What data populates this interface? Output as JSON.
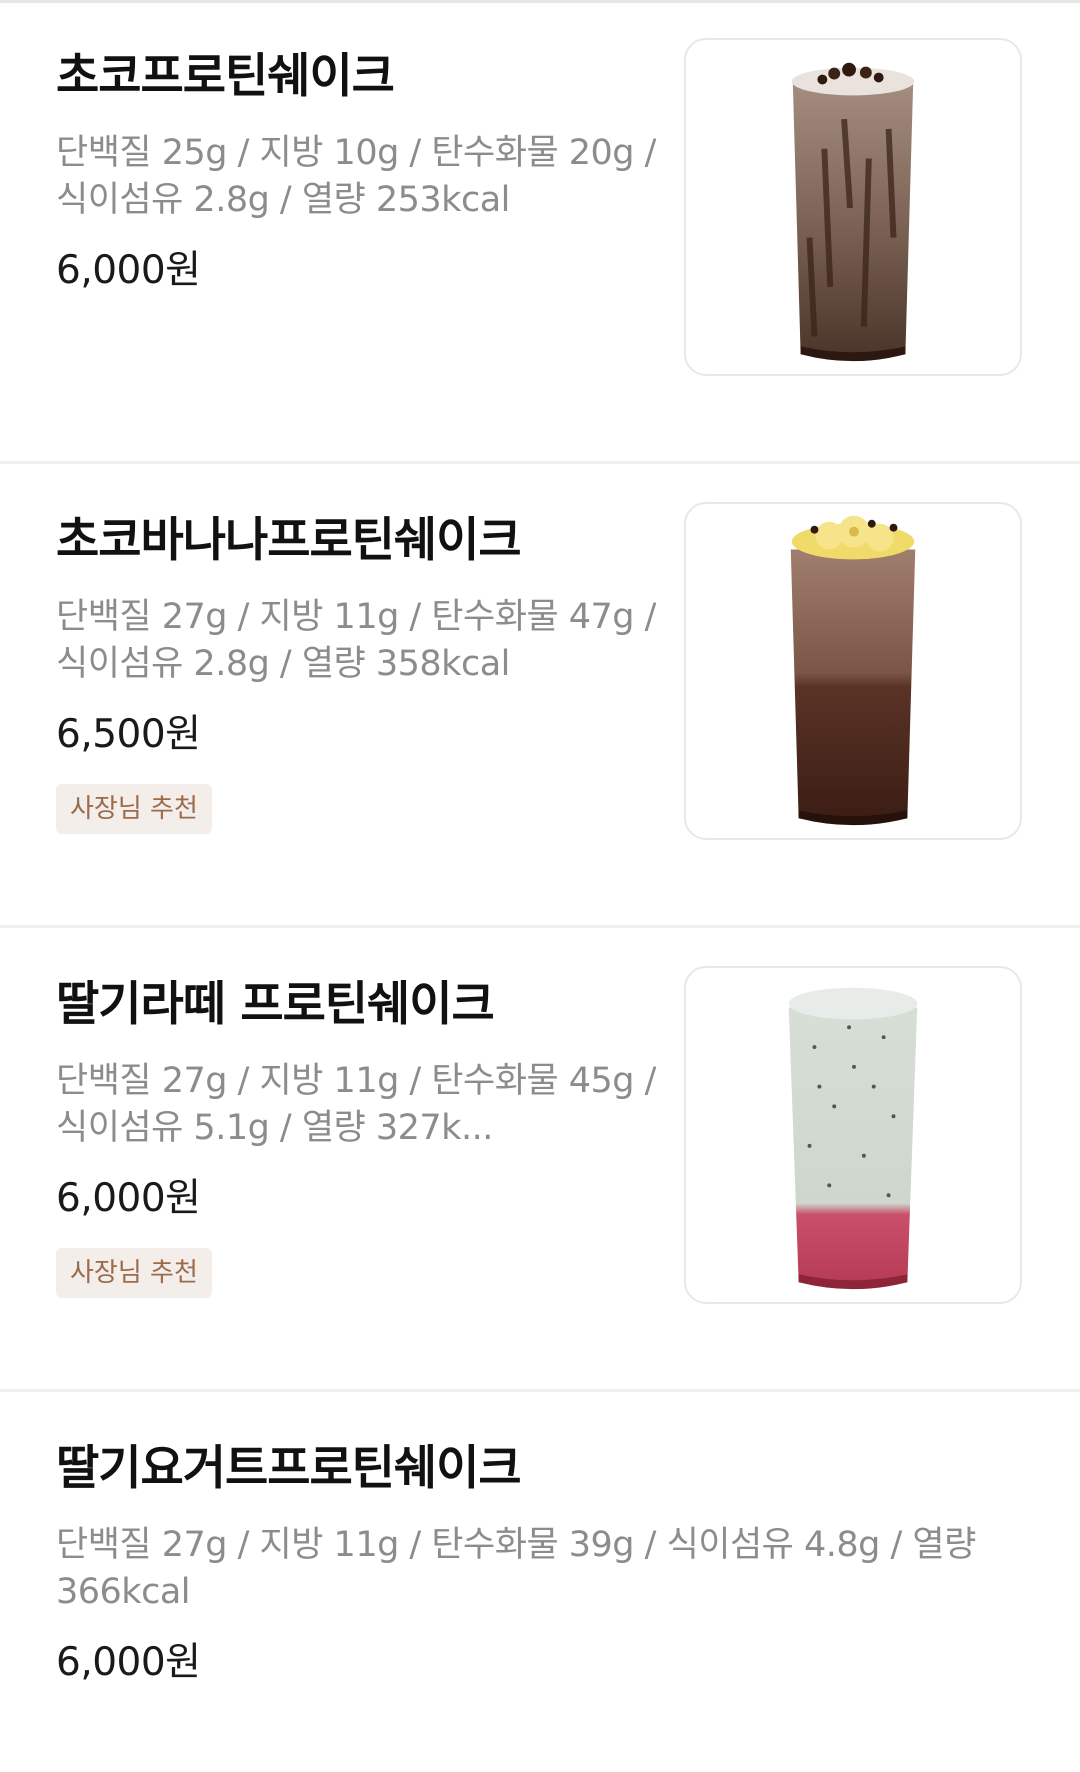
{
  "items": [
    {
      "name": "초코프로틴쉐이크",
      "desc": "단백질 25g / 지방  10g / 탄수화물 20g / 식이섬유 2.8g / 열량 253kcal",
      "price": "6,000원",
      "image_icon": "chocolate-protein-shake-image"
    },
    {
      "name": "초코바나나프로틴쉐이크",
      "desc": "단백질 27g / 지방  11g / 탄수화물 47g / 식이섬유 2.8g  /  열량 358kcal",
      "price": "6,500원",
      "badge": "사장님 추천",
      "image_icon": "choco-banana-protein-shake-image"
    },
    {
      "name": "딸기라떼 프로틴쉐이크",
      "desc": "단백질 27g / 지방  11g /  탄수화물 45g / 식이섬유 5.1g  /   열량 327k...",
      "price": "6,000원",
      "badge": "사장님 추천",
      "image_icon": "strawberry-latte-protein-shake-image"
    },
    {
      "name": "딸기요거트프로틴쉐이크",
      "desc": "단백질 27g / 지방  11g / 탄수화물 39g / 식이섬유 4.8g / 열량 366kcal",
      "price": "6,000원"
    }
  ],
  "colors": {
    "badge_text": "#9b6b4a",
    "badge_bg": "#f3eeea",
    "desc_text": "#8c8c8c"
  }
}
